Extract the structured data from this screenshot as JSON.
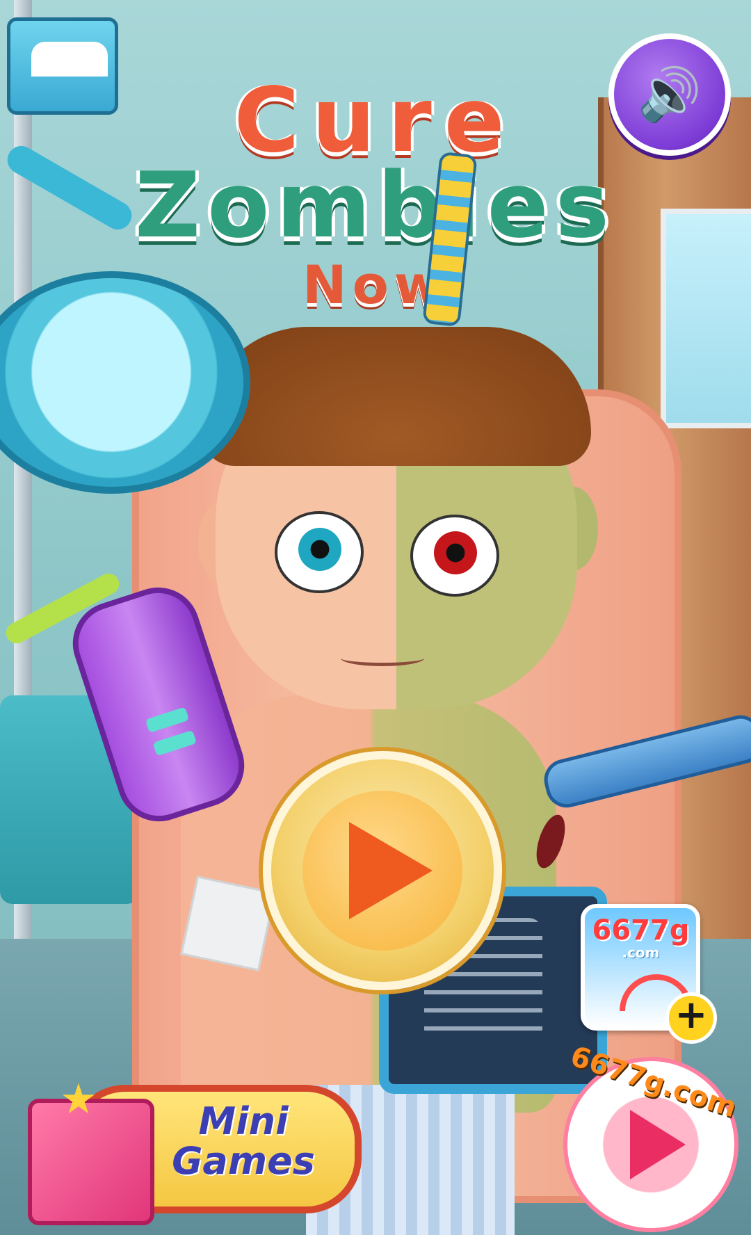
{
  "title": {
    "line1": "Cure",
    "line2": "Zombies",
    "line3": "Now"
  },
  "buttons": {
    "sound": {
      "icon": "speaker-icon"
    },
    "play": {
      "icon": "play-icon"
    },
    "mini_games": {
      "label_line1": "Mini",
      "label_line2": "Games",
      "icon": "gift-box-icon"
    },
    "ad_tile": {
      "text": "6677g",
      "sub": ".com",
      "icon": "plus-icon"
    },
    "site_play": {
      "label": "6677g.com",
      "icon": "play-icon"
    },
    "toolbox": {
      "icon": "toolbox-icon"
    }
  },
  "colors": {
    "title_red": "#ef5d3b",
    "title_green": "#2f9e7d",
    "play_orange": "#ef5a1e",
    "sound_purple": "#7d3cd6",
    "mini_games_text": "#3b3fb3"
  }
}
